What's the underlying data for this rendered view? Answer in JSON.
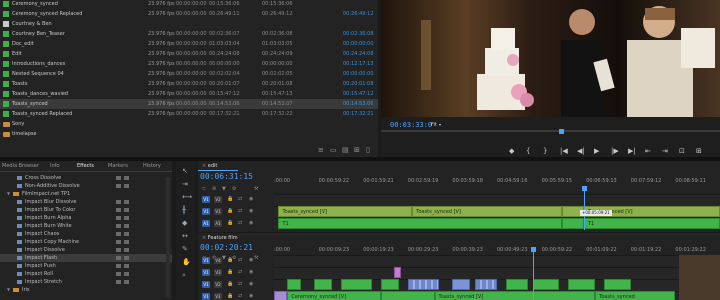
{
  "colors": {
    "accent_blue": "#4aa3ff",
    "clip_green": "#8fb04a",
    "audio_green": "#43b44a",
    "folder": "#c9903b"
  },
  "bin": {
    "rows": [
      {
        "name": "Ceremony_synced",
        "fps": "23.976 fps",
        "t1": "00:00:00:00",
        "t2": "00:15:36:06",
        "t3": "00:15:36:06",
        "t4": "",
        "color": "#3fae4a",
        "selected": false
      },
      {
        "name": "Ceremony_synced Replaced",
        "fps": "23.976 fps",
        "t1": "00:00:00:00",
        "t2": "00:26:49:11",
        "t3": "00:26:49:12",
        "t4": "00:26:49:12",
        "color": "#3fae4a",
        "selected": false
      },
      {
        "name": "Courtney & Ben",
        "fps": "",
        "t1": "",
        "t2": "",
        "t3": "",
        "t4": "",
        "color": "#c9c9c9",
        "selected": false
      },
      {
        "name": "Courtney Ben_Teaser",
        "fps": "23.976 fps",
        "t1": "00:00:00:00",
        "t2": "00:02:36:07",
        "t3": "00:02:36:08",
        "t4": "00:02:36:08",
        "color": "#3fae4a",
        "selected": false
      },
      {
        "name": "Doc_edit",
        "fps": "23.976 fps",
        "t1": "00:00:00:00",
        "t2": "01:03:03:04",
        "t3": "01:03:03:05",
        "t4": "00:00:00:00",
        "color": "#3fae4a",
        "selected": false
      },
      {
        "name": "Edit",
        "fps": "23.976 fps",
        "t1": "00:00:00:00",
        "t2": "00:24:24:08",
        "t3": "00:24:24:09",
        "t4": "00:24:24:08",
        "color": "#3fae4a",
        "selected": false
      },
      {
        "name": "Introductions_dances",
        "fps": "23.976 fps",
        "t1": "00:00:00:00",
        "t2": "00:00:00:00",
        "t3": "00:00:00:00",
        "t4": "00:12:17:13",
        "color": "#3fae4a",
        "selected": false
      },
      {
        "name": "Nested Sequence 04",
        "fps": "23.976 fps",
        "t1": "00:00:00:00",
        "t2": "00:02:02:04",
        "t3": "00:02:02:05",
        "t4": "00:00:00:00",
        "color": "#3fae4a",
        "selected": false
      },
      {
        "name": "Toasts",
        "fps": "23.976 fps",
        "t1": "00:00:00:00",
        "t2": "00:20:01:07",
        "t3": "00:20:01:08",
        "t4": "00:20:01:08",
        "color": "#3fae4a",
        "selected": false
      },
      {
        "name": "Toasts_dances_wavied",
        "fps": "23.976 fps",
        "t1": "00:00:00:00",
        "t2": "00:15:47:12",
        "t3": "00:15:47:13",
        "t4": "00:15:47:12",
        "color": "#3fae4a",
        "selected": false
      },
      {
        "name": "Toasts_synced",
        "fps": "23.976 fps",
        "t1": "00:00:00:00",
        "t2": "00:14:53:06",
        "t3": "00:14:53:07",
        "t4": "00:14:53:06",
        "color": "#3fae4a",
        "selected": true
      },
      {
        "name": "Toasts_synced Replaced",
        "fps": "23.976 fps",
        "t1": "00:00:00:00",
        "t2": "00:17:32:21",
        "t3": "00:17:32:22",
        "t4": "00:17:32:21",
        "color": "#3fae4a",
        "selected": false
      },
      {
        "name": "Sony",
        "fps": "",
        "t1": "",
        "t2": "",
        "t3": "",
        "t4": "",
        "color": "folder",
        "selected": false
      },
      {
        "name": "timelapse",
        "fps": "",
        "t1": "",
        "t2": "",
        "t3": "",
        "t4": "",
        "color": "folder",
        "selected": false
      }
    ]
  },
  "monitor": {
    "timecode": "00:03:33:0",
    "fit": "Fit",
    "controls": [
      "◆",
      "{",
      "}",
      "|◀",
      "◀|",
      "▶",
      "|▶",
      "▶|",
      "⇤",
      "⇥",
      "⊡",
      "⊞"
    ]
  },
  "effects": {
    "tabs": [
      "Media Browser",
      "Info",
      "Effects",
      "Markers",
      "History"
    ],
    "active_tab": "Effects",
    "items": [
      {
        "name": "Cross Dissolve",
        "selected": false
      },
      {
        "name": "Non-Additive Dissolve",
        "selected": false
      },
      {
        "name": "FilmImpact.net TP1",
        "selected": false,
        "folder": true
      },
      {
        "name": "Impact Blur Dissolve",
        "selected": false
      },
      {
        "name": "Impact Blur To Color",
        "selected": false
      },
      {
        "name": "Impact Burn Alpha",
        "selected": false
      },
      {
        "name": "Impact Burn White",
        "selected": false
      },
      {
        "name": "Impact Chaos",
        "selected": false
      },
      {
        "name": "Impact Copy Machine",
        "selected": false
      },
      {
        "name": "Impact Dissolve",
        "selected": false
      },
      {
        "name": "Impact Flash",
        "selected": true
      },
      {
        "name": "Impact Push",
        "selected": false
      },
      {
        "name": "Impact Roll",
        "selected": false
      },
      {
        "name": "Impact Stretch",
        "selected": false
      },
      {
        "name": "Iris",
        "selected": false,
        "folder": true
      }
    ]
  },
  "timeline1": {
    "tab": "edit",
    "timecode": "00:06:31:15",
    "ruler": [
      ":00:00",
      "00:00:59:22",
      "00:01:59:21",
      "00:02:59:19",
      "00:03:59:18",
      "00:04:59:16",
      "00:05:59:15",
      "00:06:59:13",
      "00:07:59:12",
      "00:08:59:11"
    ],
    "tracks": [
      "V2",
      "V1",
      "A1"
    ],
    "playhead_frac": 0.695,
    "tooltip": "+00:05:09:21",
    "clips": [
      {
        "track": 1,
        "start": 0.01,
        "end": 0.31,
        "label": "Toasts_synced [V]",
        "kind": "v"
      },
      {
        "track": 1,
        "start": 0.31,
        "end": 0.645,
        "label": "Toasts_synced [V]",
        "kind": "v"
      },
      {
        "track": 1,
        "start": 0.645,
        "end": 0.695,
        "label": "",
        "kind": "v"
      },
      {
        "track": 1,
        "start": 0.695,
        "end": 1.0,
        "label": "Toasts_synced [V]",
        "kind": "v"
      },
      {
        "track": 2,
        "start": 0.01,
        "end": 0.645,
        "label": "T1",
        "kind": "a"
      },
      {
        "track": 2,
        "start": 0.645,
        "end": 0.695,
        "label": "",
        "kind": "a"
      },
      {
        "track": 2,
        "start": 0.695,
        "end": 1.0,
        "label": "T1",
        "kind": "a"
      }
    ]
  },
  "timeline2": {
    "tab": "Feature film",
    "timecode": "00:02:20:21",
    "ruler": [
      ":00:00",
      "00:00:09:23",
      "00:00:19:23",
      "00:00:29:23",
      "00:00:39:23",
      "00:00:49:23",
      "00:00:59:22",
      "00:01:09:22",
      "00:01:19:22",
      "00:01:29:22"
    ],
    "tracks": [
      "V4",
      "V3",
      "V2",
      "V1"
    ],
    "playhead_frac": 0.58,
    "clips": [
      {
        "track": 1,
        "start": 0.27,
        "end": 0.285,
        "label": "",
        "kind": "p"
      },
      {
        "track": 2,
        "start": 0.03,
        "end": 0.06,
        "label": "",
        "kind": "a"
      },
      {
        "track": 2,
        "start": 0.09,
        "end": 0.13,
        "label": "",
        "kind": "a"
      },
      {
        "track": 2,
        "start": 0.15,
        "end": 0.22,
        "label": "",
        "kind": "a"
      },
      {
        "track": 2,
        "start": 0.24,
        "end": 0.28,
        "label": "",
        "kind": "a"
      },
      {
        "track": 2,
        "start": 0.3,
        "end": 0.37,
        "label": "",
        "kind": "t"
      },
      {
        "track": 2,
        "start": 0.4,
        "end": 0.44,
        "label": "",
        "kind": "b"
      },
      {
        "track": 2,
        "start": 0.45,
        "end": 0.5,
        "label": "",
        "kind": "t"
      },
      {
        "track": 2,
        "start": 0.52,
        "end": 0.57,
        "label": "",
        "kind": "a"
      },
      {
        "track": 2,
        "start": 0.58,
        "end": 0.64,
        "label": "",
        "kind": "a"
      },
      {
        "track": 2,
        "start": 0.66,
        "end": 0.72,
        "label": "",
        "kind": "a"
      },
      {
        "track": 2,
        "start": 0.74,
        "end": 0.8,
        "label": "",
        "kind": "a"
      },
      {
        "track": 3,
        "start": 0.0,
        "end": 0.03,
        "label": "",
        "kind": "s"
      },
      {
        "track": 3,
        "start": 0.03,
        "end": 0.24,
        "label": "Ceremony_synced [V]",
        "kind": "a"
      },
      {
        "track": 3,
        "start": 0.24,
        "end": 0.36,
        "label": "",
        "kind": "a"
      },
      {
        "track": 3,
        "start": 0.36,
        "end": 0.72,
        "label": "Toasts_synced [V]",
        "kind": "a"
      },
      {
        "track": 3,
        "start": 0.72,
        "end": 0.9,
        "label": "Toasts_synced",
        "kind": "a"
      }
    ]
  }
}
